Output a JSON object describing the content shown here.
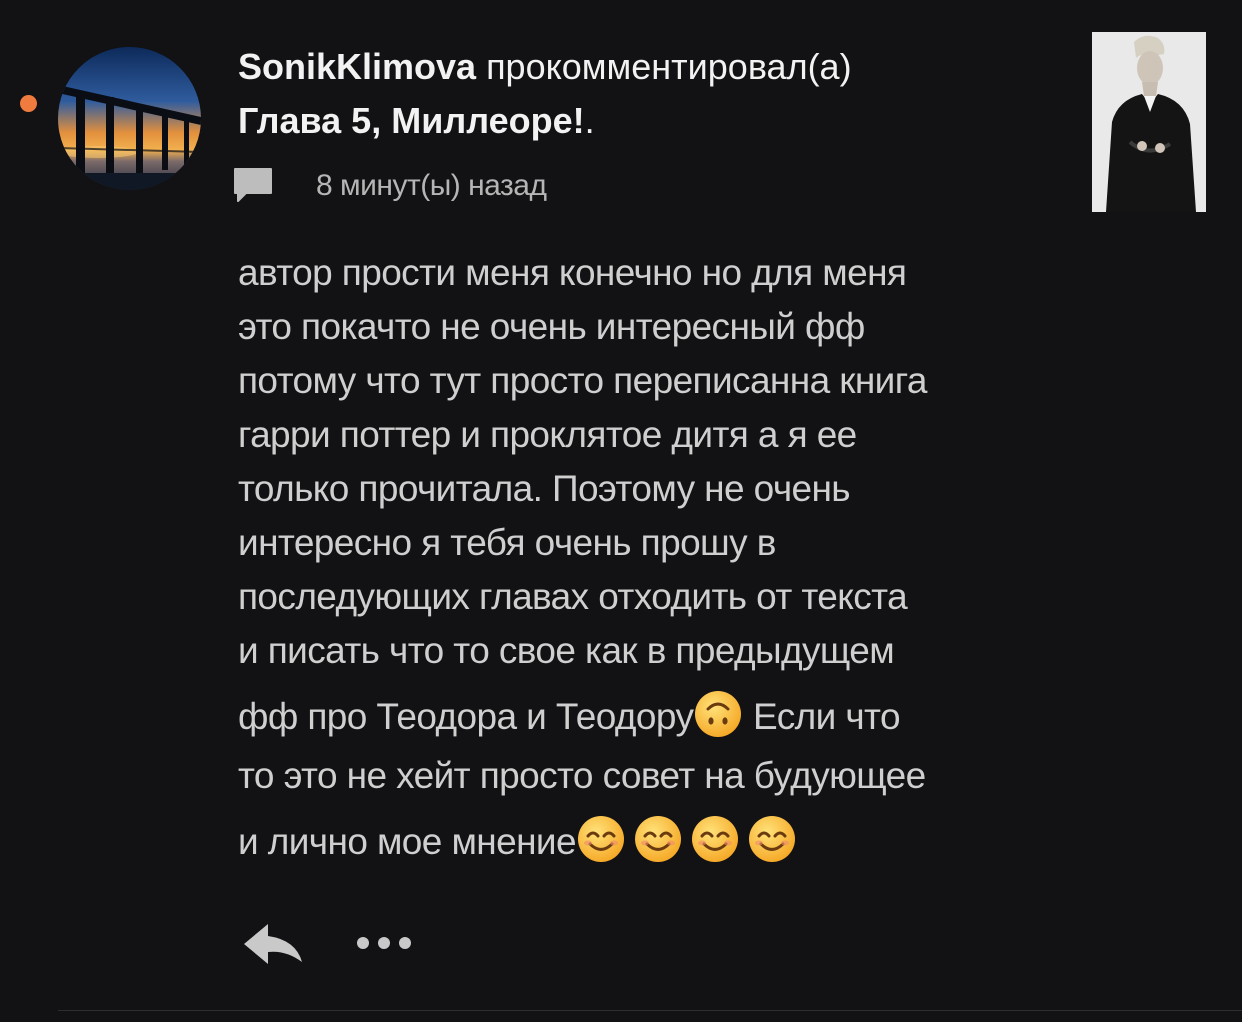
{
  "notification": {
    "unread": true,
    "accent_color": "#f07b3f",
    "avatar_icon": "bridge-sunset-avatar",
    "username": "SonikKlimova",
    "action": " прокомментировал(а)",
    "story_title": "Глава 5, Миллеоре!",
    "title_suffix": ".",
    "comment_icon": "speech-bubble-icon",
    "timestamp": "8 минут(ы) назад",
    "thumbnail": "story-cover-thumbnail"
  },
  "comment": {
    "lines": [
      "автор прости меня конечно но для меня",
      "это покачто не очень интересный фф",
      "потому что тут просто переписанна книга",
      "гарри поттер и проклятое дитя а я ее",
      "только прочитала. Поэтому не очень",
      "интересно я тебя очень прошу в",
      "последующих главах отходить от текста",
      "и писать что то свое как в предыдущем"
    ],
    "line9_text": "фф про Теодора и Теодору",
    "line9_emoji": "🙃",
    "line9_rest": " Если что",
    "line10": "то это не хейт просто совет на будующее",
    "line11_text": "и лично мое мнение",
    "line11_emojis": [
      "😊",
      "😊",
      "😊",
      "😊"
    ]
  },
  "actions": {
    "reply_icon": "reply-icon",
    "more_icon": "more-options-icon"
  }
}
